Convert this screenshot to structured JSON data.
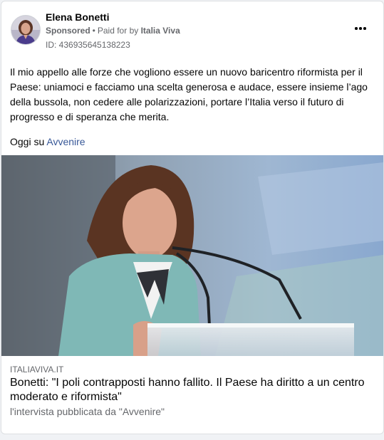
{
  "post": {
    "author": "Elena Bonetti",
    "sponsored_label": "Sponsored",
    "separator": "•",
    "paid_for_prefix": "Paid for by",
    "payer": "Italia Viva",
    "ad_id": "ID: 436935645138223",
    "more_icon": "more-options-icon",
    "body": "Il mio appello alle forze che vogliono essere un nuovo baricentro riformista per il Paese: uniamoci e facciamo una scelta generosa e audace, essere insieme l’ago della bussola, non cedere alle polarizzazioni, portare l’Italia verso il futuro di progresso e di speranza che merita.",
    "source_prefix": "Oggi su",
    "source_link": "Avvenire"
  },
  "link_preview": {
    "domain": "ITALIAVIVA.IT",
    "headline": "Bonetti: \"I poli contrapposti hanno fallito. Il Paese ha diritto a un centro moderato e riformista\"",
    "description": "l'intervista pubblicata da \"Avvenire\""
  },
  "colors": {
    "link": "#385898",
    "secondary_text": "#65676b",
    "primary_text": "#050505",
    "background": "#f0f2f5"
  }
}
